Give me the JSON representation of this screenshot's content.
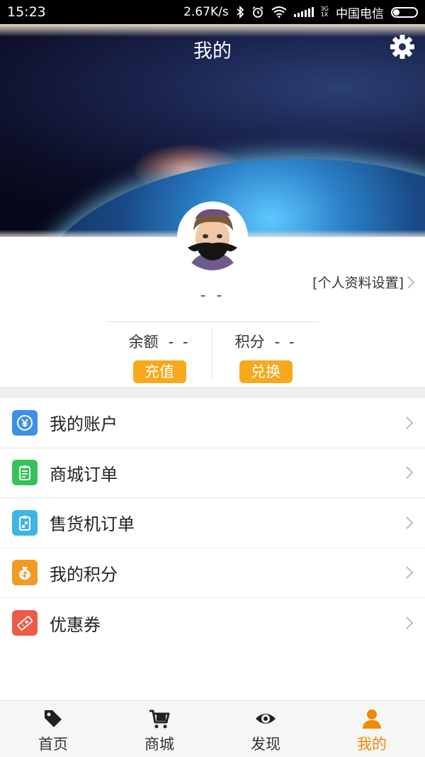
{
  "status_bar": {
    "time": "15:23",
    "speed": "2.67K/s",
    "network_type_top": "3G",
    "network_type_bottom": "1X",
    "carrier": "中国电信"
  },
  "header": {
    "title": "我的",
    "settings_icon": "gear-icon"
  },
  "profile": {
    "settings_link": "[个人资料设置]",
    "username": "- -",
    "balance_label": "余额",
    "balance_value": "- -",
    "recharge_button": "充值",
    "points_label": "积分",
    "points_value": "- -",
    "redeem_button": "兑换"
  },
  "menu": {
    "items": [
      {
        "label": "我的账户",
        "icon": "yuan-icon",
        "color": "#3f8fe3"
      },
      {
        "label": "商城订单",
        "icon": "clipboard-icon",
        "color": "#35c25a"
      },
      {
        "label": "售货机订单",
        "icon": "vending-icon",
        "color": "#3fb4e6"
      },
      {
        "label": "我的积分",
        "icon": "money-bag-icon",
        "color": "#f29a26"
      },
      {
        "label": "优惠券",
        "icon": "coupon-icon",
        "color": "#ee5a46"
      }
    ]
  },
  "bottom_nav": {
    "items": [
      {
        "label": "首页",
        "icon": "tag-icon"
      },
      {
        "label": "商城",
        "icon": "cart-icon"
      },
      {
        "label": "发现",
        "icon": "eye-icon"
      },
      {
        "label": "我的",
        "icon": "person-icon",
        "active": true
      }
    ]
  },
  "colors": {
    "accent": "#f08a00",
    "button": "#f7a81b"
  }
}
